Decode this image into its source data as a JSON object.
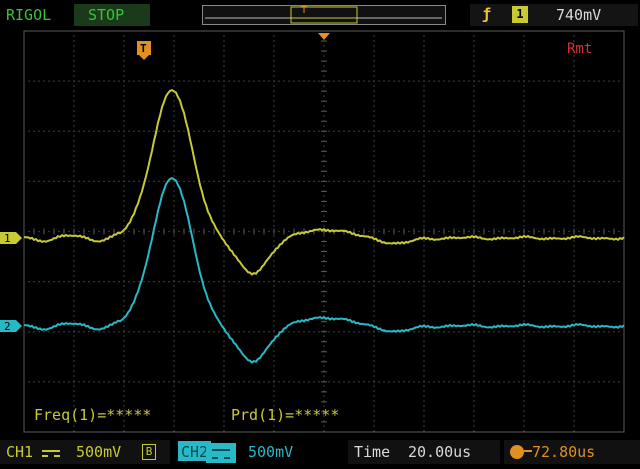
{
  "brand": "RIGOL",
  "run_state": "STOP",
  "trigger": {
    "source": "1",
    "level": "740mV",
    "mode": "Rmt",
    "marker": "T",
    "position_marker": "T"
  },
  "channels": [
    {
      "label": "1",
      "color": "#c7c935"
    },
    {
      "label": "2",
      "color": "#27b9c6"
    }
  ],
  "measurements": {
    "freq": "Freq(1)=*****",
    "period": "Prd(1)=*****"
  },
  "status": {
    "ch1_label": "CH1",
    "ch1_scale": "500mV",
    "ch1_bw": "B",
    "ch2_label": "CH2",
    "ch2_scale": "500mV",
    "time_label": "Time",
    "time_value": "20.00us",
    "trigger_offset": "72.80us"
  },
  "colors": {
    "grid": "#5a5a5a",
    "ch1": "#c7c935",
    "ch2": "#27b9c6",
    "accent_green": "#3ac33a",
    "orange": "#e09020",
    "remote": "#d83030",
    "status_text": "#d8d8d8"
  },
  "icons": {
    "coupling": "dc-coupling-icon",
    "trigger_edge": "rising-edge-icon",
    "trigger_flag": "trigger-flag-icon"
  }
}
